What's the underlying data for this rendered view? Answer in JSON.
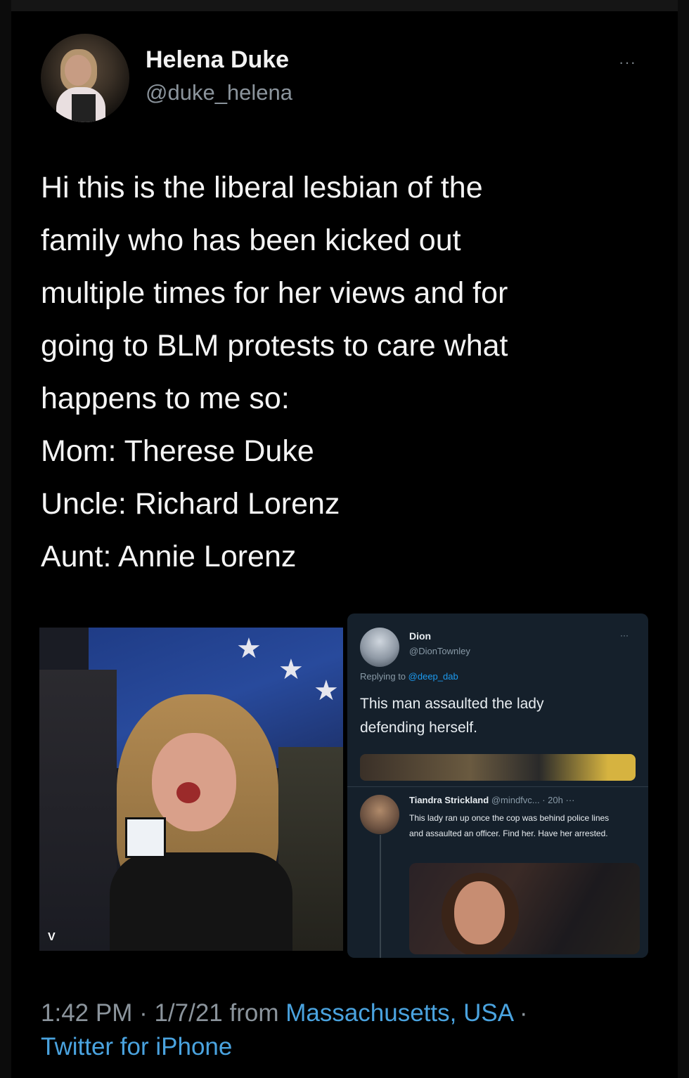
{
  "user": {
    "display_name": "Helena Duke",
    "handle": "@duke_helena"
  },
  "more_label": "···",
  "tweet_lines": [
    "Hi this is the liberal lesbian of the",
    "family who has been kicked out",
    "multiple times for her views and for",
    "going to BLM protests to care what",
    "happens to me so:",
    "Mom: Therese Duke",
    "Uncle: Richard Lorenz",
    "Aunt: Annie Lorenz"
  ],
  "media_left": {
    "corner_text": "V"
  },
  "embedded": {
    "name": "Dion",
    "handle": "@DionTownley",
    "more_label": "···",
    "replying_prefix": "Replying to",
    "replying_to": "@deep_dab",
    "text": "This man assaulted the lady defending herself.",
    "reply": {
      "name": "Tiandra Strickland",
      "meta": "@mindfvc... · 20h",
      "more_label": "···",
      "text": "This lady ran up once the cop was behind police lines and assaulted an officer. Find her. Have her arrested."
    }
  },
  "footer": {
    "time_date": "1:42 PM · 1/7/21 from",
    "location": "Massachusetts, USA",
    "separator": " ·",
    "client": "Twitter for iPhone"
  },
  "colors": {
    "background": "#000000",
    "text": "#f4f4f4",
    "muted": "#8b949c",
    "link": "#4aa3df",
    "embed_bg": "#15202b"
  }
}
